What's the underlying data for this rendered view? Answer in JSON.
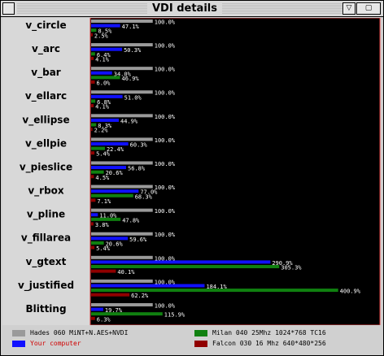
{
  "window": {
    "title": "VDI details",
    "controls": [
      "close-box",
      "iconify-box",
      "fullsize-box"
    ]
  },
  "colors": {
    "reference": "#9a9a9a",
    "your_computer": "#1010ff",
    "milan": "#108010",
    "falcon": "#900000",
    "plot_bg": "#000000",
    "plot_border": "#e04040",
    "your_computer_text": "#d00000"
  },
  "legend": [
    {
      "label": "Hades 060 MiNT+N.AES+NVDI",
      "color": "#9a9a9a"
    },
    {
      "label": "Milan 040 25Mhz 1024*768 TC16",
      "color": "#108010"
    },
    {
      "label": "Your computer",
      "color": "#1010ff"
    },
    {
      "label": "Falcon 030 16 Mhz 640*480*256",
      "color": "#900000"
    }
  ],
  "chart_data": {
    "type": "bar",
    "orientation": "horizontal",
    "title": "VDI details",
    "categories": [
      "v_circle",
      "v_arc",
      "v_bar",
      "v_ellarc",
      "v_ellipse",
      "v_ellpie",
      "v_pieslice",
      "v_rbox",
      "v_pline",
      "v_fillarea",
      "v_gtext",
      "v_justified",
      "Blitting"
    ],
    "series": [
      {
        "name": "Hades 060 MiNT+N.AES+NVDI",
        "values": [
          100.0,
          100.0,
          100.0,
          100.0,
          100.0,
          100.0,
          100.0,
          100.0,
          100.0,
          100.0,
          100.0,
          100.0,
          100.0
        ]
      },
      {
        "name": "Your computer",
        "values": [
          47.1,
          50.3,
          34.0,
          51.0,
          44.9,
          60.3,
          56.8,
          77.0,
          11.0,
          59.6,
          290.9,
          184.1,
          19.7
        ]
      },
      {
        "name": "Milan 040 25Mhz 1024*768 TC16",
        "values": [
          8.5,
          6.4,
          46.9,
          6.8,
          8.3,
          22.4,
          20.6,
          68.3,
          47.8,
          20.6,
          305.3,
          400.9,
          115.9
        ]
      },
      {
        "name": "Falcon 030 16 Mhz 640*480*256",
        "values": [
          2.5,
          4.1,
          6.0,
          4.1,
          2.2,
          5.4,
          4.5,
          7.1,
          3.8,
          5.4,
          40.1,
          62.2,
          6.3
        ]
      }
    ],
    "value_suffix": "%",
    "xlim": [
      0,
      470
    ],
    "grid": false,
    "legend_position": "bottom"
  }
}
